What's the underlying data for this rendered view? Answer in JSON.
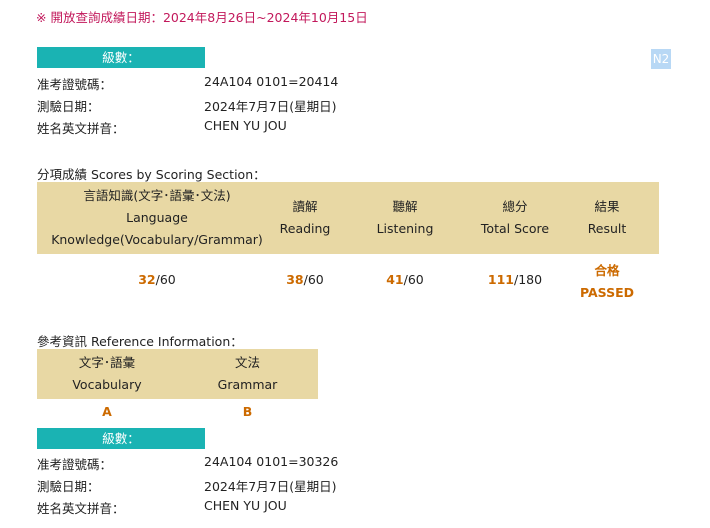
{
  "notice": "※ 開放查詢成績日期：2024年8月26日~2024年10月15日",
  "badge": "N2",
  "records": [
    {
      "level_label": "級數：",
      "exam_no_label": "准考證號碼：",
      "exam_no": "24A104 0101=20414",
      "date_label": "測驗日期：",
      "date": "2024年7月7日(星期日)",
      "name_label": "姓名英文拼音：",
      "name": "CHEN YU JOU"
    },
    {
      "level_label": "級數：",
      "exam_no_label": "准考證號碼：",
      "exam_no": "24A104 0101=30326",
      "date_label": "測驗日期：",
      "date": "2024年7月7日(星期日)",
      "name_label": "姓名英文拼音：",
      "name": "CHEN YU JOU"
    }
  ],
  "scores": {
    "title": "分項成績 Scores by Scoring Section：",
    "headers": [
      {
        "zh": "言語知識(文字･語彙･文法)",
        "en1": "Language",
        "en2": "Knowledge(Vocabulary/Grammar)"
      },
      {
        "zh": "讀解",
        "en1": "Reading"
      },
      {
        "zh": "聽解",
        "en1": "Listening"
      },
      {
        "zh": "總分",
        "en1": "Total Score"
      },
      {
        "zh": "結果",
        "en1": "Result"
      }
    ],
    "values": [
      {
        "score": "32",
        "max": "/60"
      },
      {
        "score": "38",
        "max": "/60"
      },
      {
        "score": "41",
        "max": "/60"
      },
      {
        "score": "111",
        "max": "/180"
      }
    ],
    "result_zh": "合格",
    "result_en": "PASSED"
  },
  "reference": {
    "title": "參考資訊 Reference Information：",
    "headers": [
      {
        "zh": "文字･語彙",
        "en": "Vocabulary"
      },
      {
        "zh": "文法",
        "en": "Grammar"
      }
    ],
    "grades": [
      "A",
      "B"
    ]
  }
}
